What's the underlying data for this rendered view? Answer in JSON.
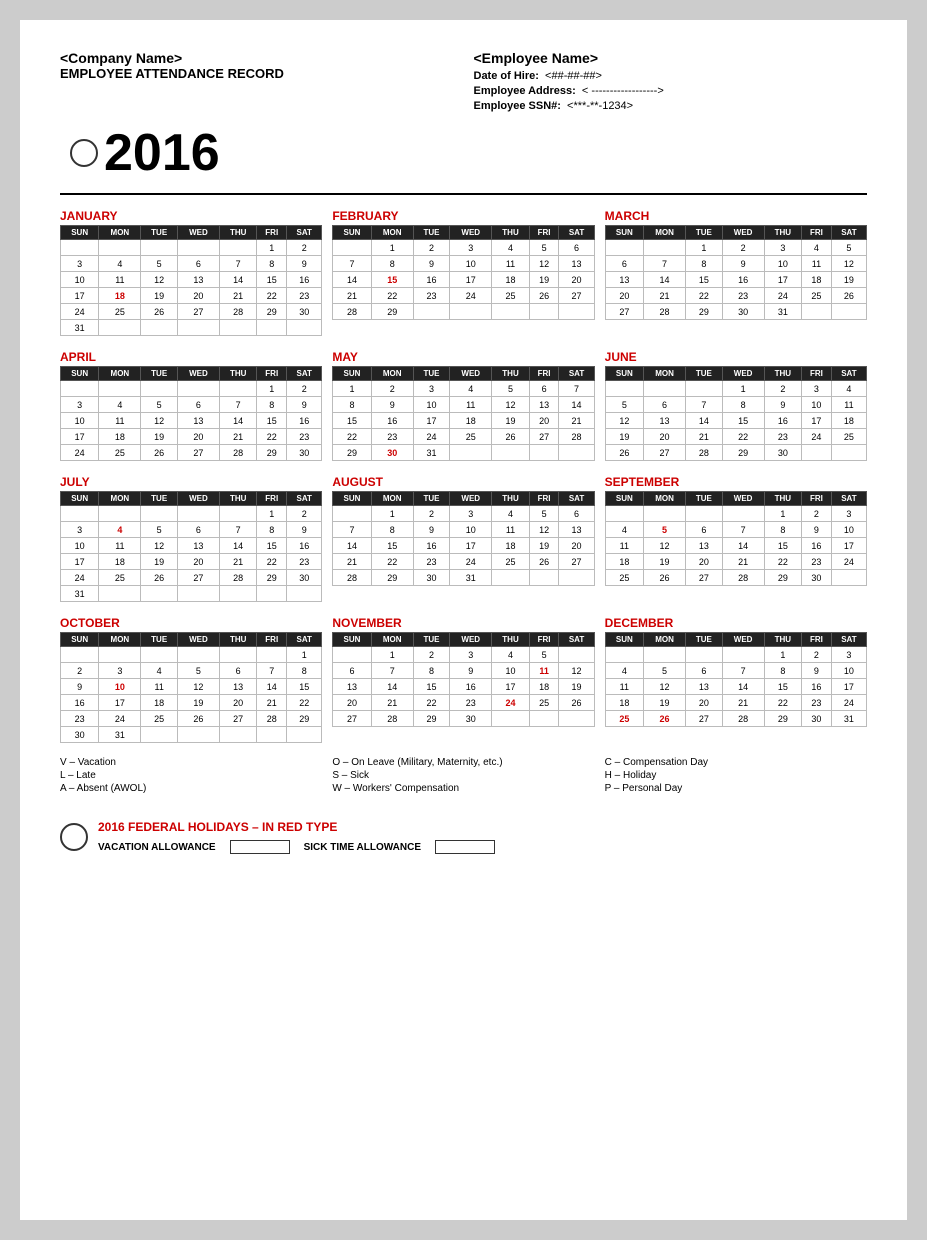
{
  "header": {
    "company_name": "<Company Name>",
    "record_title": "EMPLOYEE ATTENDANCE RECORD",
    "year": "2016",
    "employee_name": "<Employee Name>",
    "date_of_hire_label": "Date of Hire:",
    "date_of_hire_value": "<##-##-##>",
    "address_label": "Employee Address:",
    "address_value": "< ------------------>",
    "ssn_label": "Employee SSN#:",
    "ssn_value": "<***-**-1234>"
  },
  "months": [
    {
      "name": "JANUARY",
      "days": [
        [
          "",
          "",
          "",
          "",
          "",
          "1",
          "2"
        ],
        [
          "3",
          "4",
          "5",
          "6",
          "7",
          "8",
          "9"
        ],
        [
          "10",
          "11",
          "12",
          "13",
          "14",
          "15",
          "16"
        ],
        [
          "17",
          "18r",
          "19",
          "20",
          "21",
          "22",
          "23"
        ],
        [
          "24",
          "25",
          "26",
          "27",
          "28",
          "29",
          "30"
        ],
        [
          "31",
          "",
          "",
          "",
          "",
          "",
          ""
        ]
      ]
    },
    {
      "name": "FEBRUARY",
      "days": [
        [
          "",
          "1",
          "2",
          "3",
          "4",
          "5",
          "6"
        ],
        [
          "7",
          "8",
          "9",
          "10",
          "11",
          "12",
          "13"
        ],
        [
          "14",
          "15r",
          "16",
          "17",
          "18",
          "19",
          "20"
        ],
        [
          "21",
          "22",
          "23",
          "24",
          "25",
          "26",
          "27"
        ],
        [
          "28",
          "29",
          "",
          "",
          "",
          "",
          ""
        ]
      ]
    },
    {
      "name": "MARCH",
      "days": [
        [
          "",
          "",
          "1",
          "2",
          "3",
          "4",
          "5"
        ],
        [
          "6",
          "7",
          "8",
          "9",
          "10",
          "11",
          "12"
        ],
        [
          "13",
          "14",
          "15",
          "16",
          "17",
          "18",
          "19"
        ],
        [
          "20",
          "21",
          "22",
          "23",
          "24",
          "25",
          "26"
        ],
        [
          "27",
          "28",
          "29",
          "30",
          "31",
          "",
          ""
        ]
      ]
    },
    {
      "name": "APRIL",
      "days": [
        [
          "",
          "",
          "",
          "",
          "",
          "1",
          "2"
        ],
        [
          "3",
          "4",
          "5",
          "6",
          "7",
          "8",
          "9"
        ],
        [
          "10",
          "11",
          "12",
          "13",
          "14",
          "15",
          "16"
        ],
        [
          "17",
          "18",
          "19",
          "20",
          "21",
          "22",
          "23"
        ],
        [
          "24",
          "25",
          "26",
          "27",
          "28",
          "29",
          "30"
        ]
      ]
    },
    {
      "name": "MAY",
      "days": [
        [
          "1",
          "2",
          "3",
          "4",
          "5",
          "6",
          "7"
        ],
        [
          "8",
          "9",
          "10",
          "11",
          "12",
          "13",
          "14"
        ],
        [
          "15",
          "16",
          "17",
          "18",
          "19",
          "20",
          "21"
        ],
        [
          "22",
          "23",
          "24",
          "25",
          "26",
          "27",
          "28"
        ],
        [
          "29",
          "30r",
          "31",
          "",
          "",
          "",
          ""
        ]
      ]
    },
    {
      "name": "JUNE",
      "days": [
        [
          "",
          "",
          "",
          "1",
          "2",
          "3",
          "4"
        ],
        [
          "5",
          "6",
          "7",
          "8",
          "9",
          "10",
          "11"
        ],
        [
          "12",
          "13",
          "14",
          "15",
          "16",
          "17",
          "18"
        ],
        [
          "19",
          "20",
          "21",
          "22",
          "23",
          "24",
          "25"
        ],
        [
          "26",
          "27",
          "28",
          "29",
          "30",
          "",
          ""
        ]
      ]
    },
    {
      "name": "JULY",
      "days": [
        [
          "",
          "",
          "",
          "",
          "",
          "1",
          "2"
        ],
        [
          "3",
          "4r",
          "5",
          "6",
          "7",
          "8",
          "9"
        ],
        [
          "10",
          "11",
          "12",
          "13",
          "14",
          "15",
          "16"
        ],
        [
          "17",
          "18",
          "19",
          "20",
          "21",
          "22",
          "23"
        ],
        [
          "24",
          "25",
          "26",
          "27",
          "28",
          "29",
          "30"
        ],
        [
          "31",
          "",
          "",
          "",
          "",
          "",
          ""
        ]
      ]
    },
    {
      "name": "AUGUST",
      "days": [
        [
          "",
          "1",
          "2",
          "3",
          "4",
          "5",
          "6"
        ],
        [
          "7",
          "8",
          "9",
          "10",
          "11",
          "12",
          "13"
        ],
        [
          "14",
          "15",
          "16",
          "17",
          "18",
          "19",
          "20"
        ],
        [
          "21",
          "22",
          "23",
          "24",
          "25",
          "26",
          "27"
        ],
        [
          "28",
          "29",
          "30",
          "31",
          "",
          "",
          ""
        ]
      ]
    },
    {
      "name": "SEPTEMBER",
      "days": [
        [
          "",
          "",
          "",
          "",
          "1",
          "2",
          "3"
        ],
        [
          "4",
          "5r",
          "6",
          "7",
          "8",
          "9",
          "10"
        ],
        [
          "11",
          "12",
          "13",
          "14",
          "15",
          "16",
          "17"
        ],
        [
          "18",
          "19",
          "20",
          "21",
          "22",
          "23",
          "24"
        ],
        [
          "25",
          "26",
          "27",
          "28",
          "29",
          "30",
          ""
        ]
      ]
    },
    {
      "name": "OCTOBER",
      "days": [
        [
          "",
          "",
          "",
          "",
          "",
          "",
          "1"
        ],
        [
          "2",
          "3",
          "4",
          "5",
          "6",
          "7",
          "8"
        ],
        [
          "9",
          "10r",
          "11",
          "12",
          "13",
          "14",
          "15"
        ],
        [
          "16",
          "17",
          "18",
          "19",
          "20",
          "21",
          "22"
        ],
        [
          "23",
          "24",
          "25",
          "26",
          "27",
          "28",
          "29"
        ],
        [
          "30",
          "31",
          "",
          "",
          "",
          "",
          ""
        ]
      ]
    },
    {
      "name": "NOVEMBER",
      "days": [
        [
          "",
          "1",
          "2",
          "3",
          "4",
          "5",
          ""
        ],
        [
          "6",
          "7",
          "8",
          "9",
          "10",
          "11r",
          "12"
        ],
        [
          "13",
          "14",
          "15",
          "16",
          "17",
          "18",
          "19"
        ],
        [
          "20",
          "21",
          "22",
          "23",
          "24r",
          "25",
          "26"
        ],
        [
          "27",
          "28",
          "29",
          "30",
          "",
          "",
          ""
        ]
      ]
    },
    {
      "name": "DECEMBER",
      "days": [
        [
          "",
          "",
          "",
          "",
          "1",
          "2",
          "3"
        ],
        [
          "4",
          "5",
          "6",
          "7",
          "8",
          "9",
          "10"
        ],
        [
          "11",
          "12",
          "13",
          "14",
          "15",
          "16",
          "17"
        ],
        [
          "18",
          "19",
          "20",
          "21",
          "22",
          "23",
          "24"
        ],
        [
          "25r",
          "26r",
          "27",
          "28",
          "29",
          "30",
          "31"
        ]
      ]
    }
  ],
  "day_headers": [
    "SUN",
    "MON",
    "TUE",
    "WED",
    "THU",
    "FRI",
    "SAT"
  ],
  "legend": {
    "col1": [
      "V – Vacation",
      "L – Late",
      "A – Absent (AWOL)"
    ],
    "col2": [
      "O – On Leave (Military, Maternity, etc.)",
      "S – Sick",
      "W – Workers' Compensation"
    ],
    "col3": [
      "C – Compensation Day",
      "H – Holiday",
      "P – Personal Day"
    ]
  },
  "holidays": {
    "title": "2016 FEDERAL HOLIDAYS – IN RED TYPE",
    "vacation_label": "VACATION ALLOWANCE",
    "sick_label": "SICK TIME  ALLOWANCE"
  }
}
